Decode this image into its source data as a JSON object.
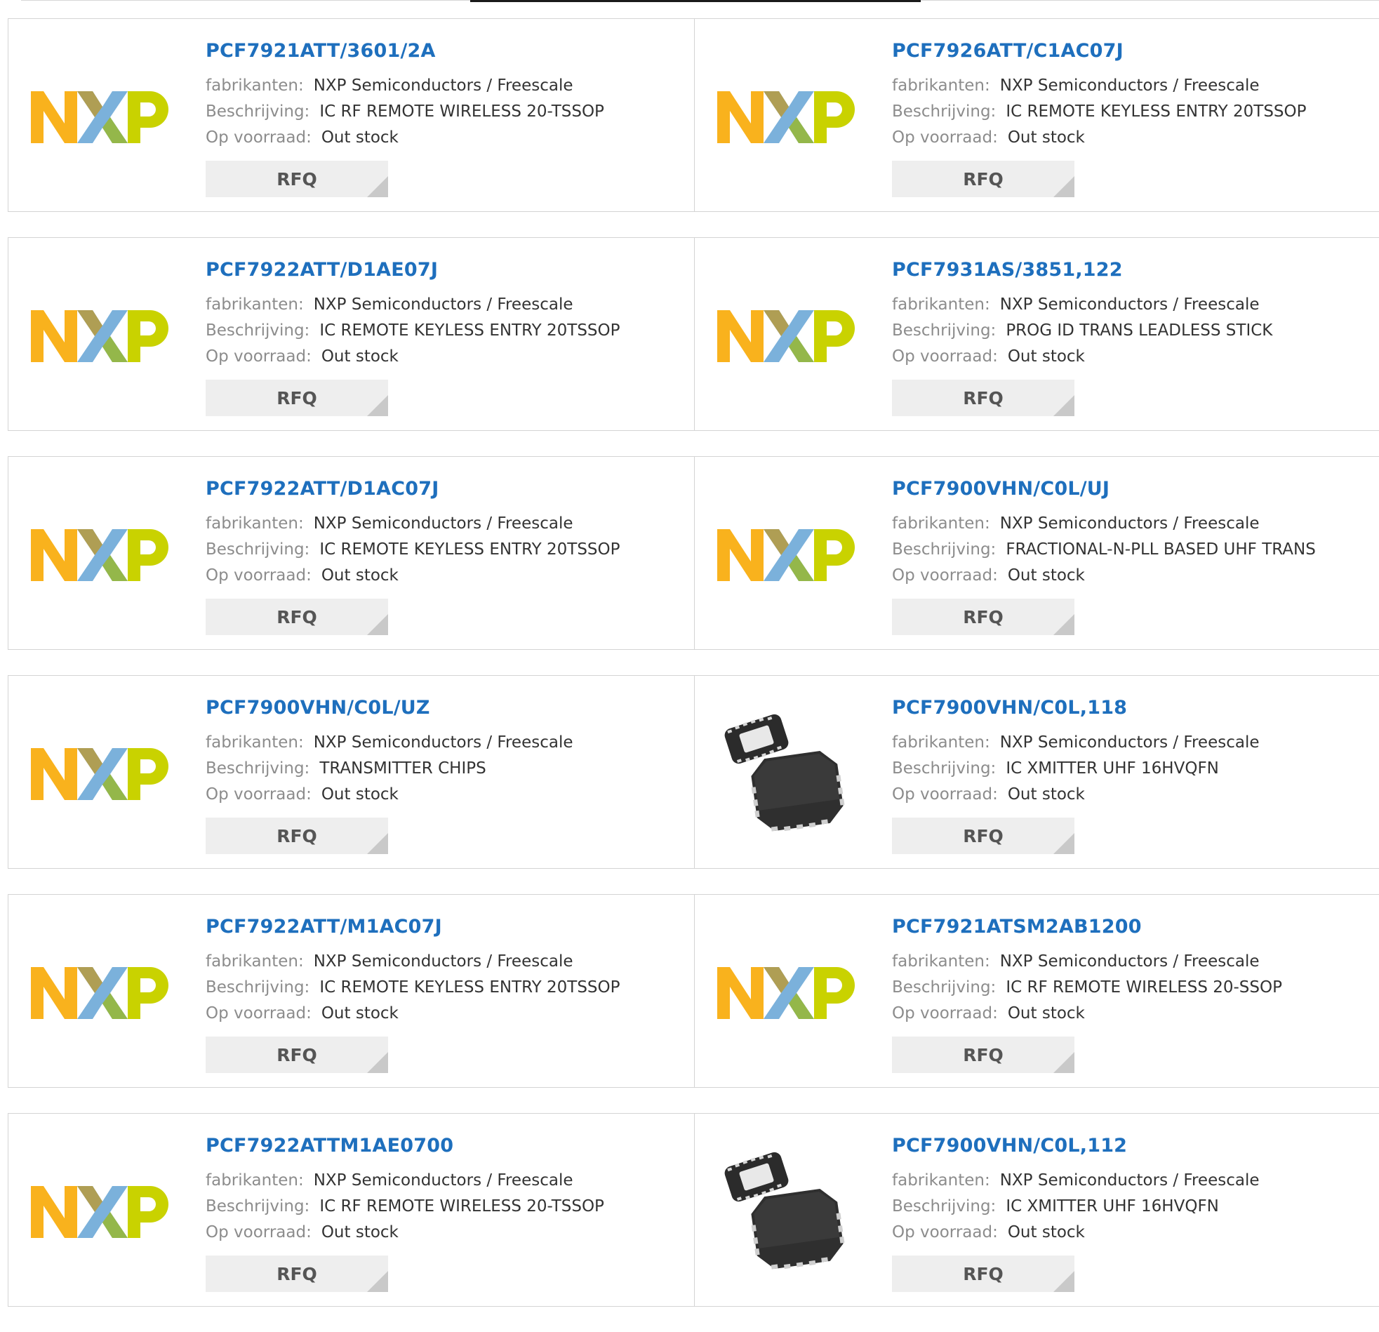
{
  "labels": {
    "manufacturer": "fabrikanten:",
    "description": "Beschrijving:",
    "stock": "Op voorraad:",
    "rfq": "RFQ"
  },
  "products": [
    {
      "part": "PCF7921ATT/3601/2A",
      "manufacturer": "NXP Semiconductors / Freescale",
      "description": "IC RF REMOTE WIRELESS 20-TSSOP",
      "stock": "Out stock",
      "image": "nxp-logo"
    },
    {
      "part": "PCF7926ATT/C1AC07J",
      "manufacturer": "NXP Semiconductors / Freescale",
      "description": "IC REMOTE KEYLESS ENTRY 20TSSOP",
      "stock": "Out stock",
      "image": "nxp-logo"
    },
    {
      "part": "PCF7922ATT/D1AE07J",
      "manufacturer": "NXP Semiconductors / Freescale",
      "description": "IC REMOTE KEYLESS ENTRY 20TSSOP",
      "stock": "Out stock",
      "image": "nxp-logo"
    },
    {
      "part": "PCF7931AS/3851,122",
      "manufacturer": "NXP Semiconductors / Freescale",
      "description": "PROG ID TRANS LEADLESS STICK",
      "stock": "Out stock",
      "image": "nxp-logo"
    },
    {
      "part": "PCF7922ATT/D1AC07J",
      "manufacturer": "NXP Semiconductors / Freescale",
      "description": "IC REMOTE KEYLESS ENTRY 20TSSOP",
      "stock": "Out stock",
      "image": "nxp-logo"
    },
    {
      "part": "PCF7900VHN/C0L/UJ",
      "manufacturer": "NXP Semiconductors / Freescale",
      "description": "FRACTIONAL-N-PLL BASED UHF TRANS",
      "stock": "Out stock",
      "image": "nxp-logo"
    },
    {
      "part": "PCF7900VHN/C0L/UZ",
      "manufacturer": "NXP Semiconductors / Freescale",
      "description": "TRANSMITTER CHIPS",
      "stock": "Out stock",
      "image": "nxp-logo"
    },
    {
      "part": "PCF7900VHN/C0L,118",
      "manufacturer": "NXP Semiconductors / Freescale",
      "description": "IC XMITTER UHF 16HVQFN",
      "stock": "Out stock",
      "image": "qfn-chip-photo"
    },
    {
      "part": "PCF7922ATT/M1AC07J",
      "manufacturer": "NXP Semiconductors / Freescale",
      "description": "IC REMOTE KEYLESS ENTRY 20TSSOP",
      "stock": "Out stock",
      "image": "nxp-logo"
    },
    {
      "part": "PCF7921ATSM2AB1200",
      "manufacturer": "NXP Semiconductors / Freescale",
      "description": "IC RF REMOTE WIRELESS 20-SSOP",
      "stock": "Out stock",
      "image": "nxp-logo"
    },
    {
      "part": "PCF7922ATTM1AE0700",
      "manufacturer": "NXP Semiconductors / Freescale",
      "description": "IC RF REMOTE WIRELESS 20-TSSOP",
      "stock": "Out stock",
      "image": "nxp-logo"
    },
    {
      "part": "PCF7900VHN/C0L,112",
      "manufacturer": "NXP Semiconductors / Freescale",
      "description": "IC XMITTER UHF 16HVQFN",
      "stock": "Out stock",
      "image": "qfn-chip-photo"
    }
  ],
  "colors": {
    "part_link": "#1e6fbd",
    "label_grey": "#8c8c8c",
    "value_text": "#333333",
    "rfq_bg": "#eeeeee",
    "nxp_orange": "#f9b21d",
    "nxp_blue": "#7bb1db",
    "nxp_green": "#c9d200"
  }
}
